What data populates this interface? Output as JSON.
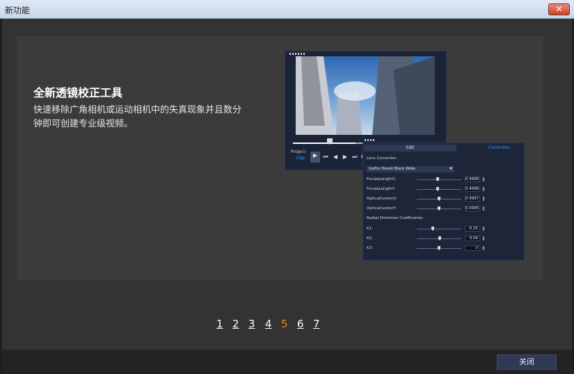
{
  "window": {
    "title": "新功能",
    "close_glyph": "✕"
  },
  "slide": {
    "heading": "全新透镜校正工具",
    "description": "快速移除广角相机或运动相机中的失真现象并且数分钟即可创建专业级视频。"
  },
  "player": {
    "mode_project": "Project–",
    "mode_clip": "Clip–",
    "controls": [
      "play-icon",
      "skip-start-icon",
      "step-back-icon",
      "step-forward-icon",
      "skip-end-icon",
      "repeat-icon"
    ]
  },
  "correction_panel": {
    "tab_edit": "Edit",
    "tab_correction": "Correction",
    "section_title": "Lens Correction",
    "preset": "GoPro Hero4 Black Wide",
    "params": [
      {
        "label": "FocalaLengthX:",
        "value": "0.4688"
      },
      {
        "label": "FocalaLengthY:",
        "value": "0.4688"
      },
      {
        "label": "OpticalCenterX:",
        "value": "0.4997"
      },
      {
        "label": "OpticalCenterY:",
        "value": "0.4995"
      }
    ],
    "radial_title": "Radial Distortion Coefficients:",
    "coefficients": [
      {
        "label": "K1:",
        "value": "-0.25"
      },
      {
        "label": "K2:",
        "value": "0.06"
      },
      {
        "label": "K3:",
        "value": "0"
      }
    ]
  },
  "pagination": {
    "pages": [
      "1",
      "2",
      "3",
      "4",
      "5",
      "6",
      "7"
    ],
    "current": "5"
  },
  "footer": {
    "close_label": "关闭"
  },
  "colors": {
    "accent_blue": "#3aa0ff",
    "current_page": "#e0892a",
    "background": "#333333"
  }
}
